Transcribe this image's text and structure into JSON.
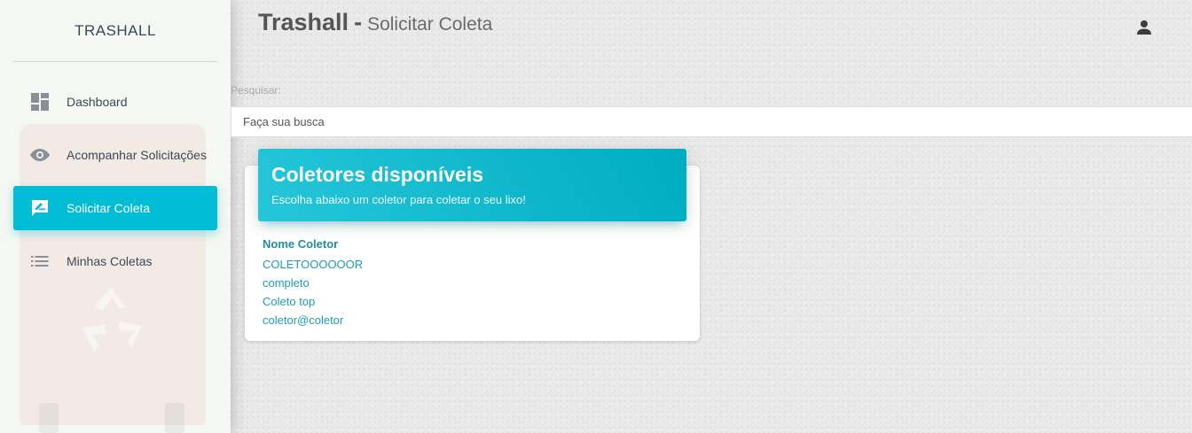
{
  "sidebar": {
    "brand": "TRASHALL",
    "items": [
      {
        "label": "Dashboard",
        "icon": "dashboard-icon"
      },
      {
        "label": "Acompanhar Solicitações",
        "icon": "eye-icon"
      },
      {
        "label": "Solicitar Coleta",
        "icon": "rate-review-icon",
        "active": true
      },
      {
        "label": "Minhas Coletas",
        "icon": "list-icon"
      }
    ]
  },
  "header": {
    "title": "Trashall",
    "separator": "-",
    "subtitle": "Solicitar Coleta",
    "user_icon": "person-icon"
  },
  "search": {
    "label": "Pesquisar:",
    "placeholder": "Faça sua busca",
    "value": ""
  },
  "card": {
    "title": "Coletores disponíveis",
    "subtitle": "Escolha abaixo um coletor para coletar o seu lixo!",
    "column_header": "Nome Coletor",
    "collectors": [
      "COLETOOOOOOR",
      "completo",
      "Coleto top",
      "coletor@coletor"
    ]
  },
  "colors": {
    "accent": "#00bcd4",
    "sidebar_bg": "#f4f7f2",
    "link": "#1e9db2",
    "text": "#3c4858"
  }
}
